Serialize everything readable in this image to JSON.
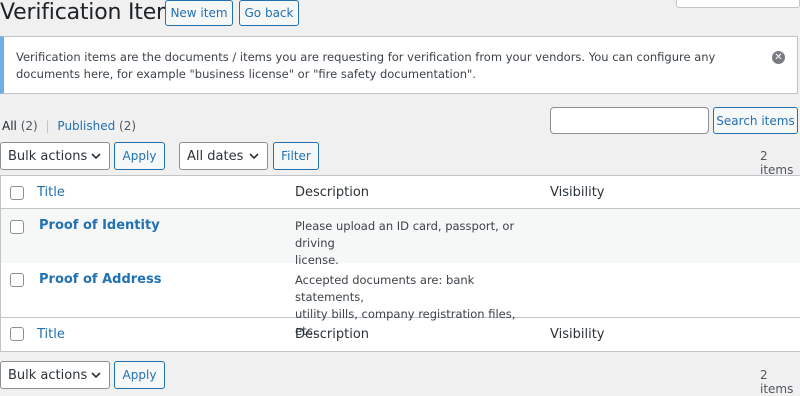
{
  "header": {
    "title": "Verification Items",
    "new_item_label": "New item",
    "go_back_label": "Go back"
  },
  "notice": {
    "text": "Verification items are the documents / items you are requesting for verification from your vendors. You can configure any documents here, for example \"business license\" or \"fire safety documentation\".",
    "dismiss_icon": "close-circle-icon"
  },
  "views": {
    "all_label": "All",
    "all_count": "(2)",
    "separator": "|",
    "published_label": "Published",
    "published_count": "(2)"
  },
  "search": {
    "value": "",
    "button_label": "Search items"
  },
  "top_nav": {
    "bulk_actions": "Bulk actions",
    "apply_label": "Apply",
    "dates": "All dates",
    "filter_label": "Filter",
    "items_count": "2 items"
  },
  "table": {
    "columns": [
      "Title",
      "Description",
      "Visibility"
    ],
    "rows": [
      {
        "title": "Proof of Identity",
        "description_line1": "Please upload an ID card, passport, or driving",
        "description_line2": "license.",
        "visibility": ""
      },
      {
        "title": "Proof of Address",
        "description_line1": "Accepted documents are: bank statements,",
        "description_line2": "utility bills, company registration files, etc.",
        "visibility": ""
      }
    ]
  },
  "bottom_nav": {
    "bulk_actions": "Bulk actions",
    "apply_label": "Apply",
    "items_count": "2 items"
  },
  "colors": {
    "accent": "#2271b1",
    "notice_border": "#72aee6",
    "background": "#f0f0f1"
  }
}
